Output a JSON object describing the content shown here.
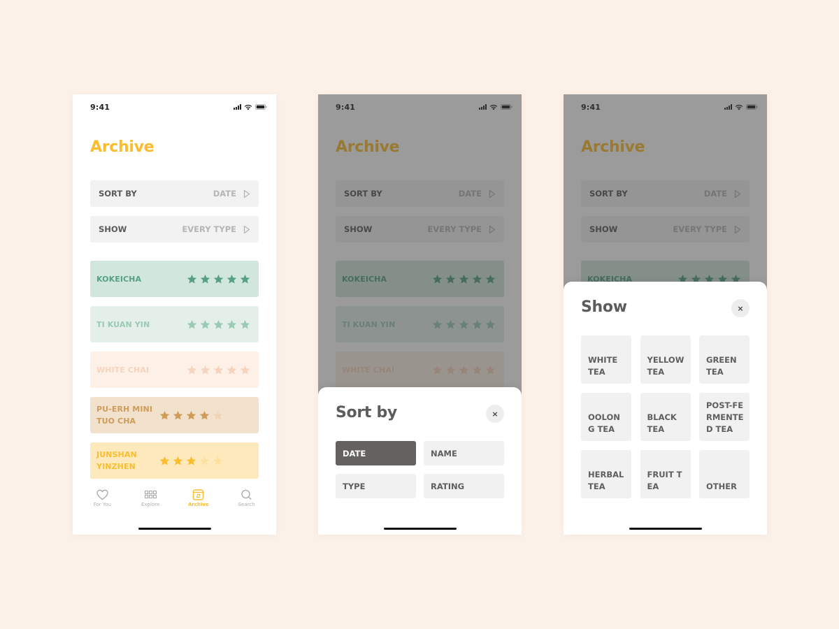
{
  "colors": {
    "background": "#fcf1e8",
    "accent": "#fbbd2f",
    "selected_option": "#64625e"
  },
  "status_bar": {
    "time": "9:41"
  },
  "archive": {
    "title": "Archive",
    "sort_row": {
      "label": "SORT BY",
      "value": "DATE"
    },
    "show_row": {
      "label": "SHOW",
      "value": "EVERY TYPE"
    },
    "teas": [
      {
        "name": "KOKEICHA",
        "rating": 5,
        "bg": "#d1e6dc",
        "text": "#57a182",
        "star_on": "#57a182",
        "star_off": "#bddbcd"
      },
      {
        "name": "TI KUAN YIN",
        "rating": 5,
        "bg": "#e3efe8",
        "text": "#9bcab2",
        "star_on": "#9bcab2",
        "star_off": "#cfe3d8"
      },
      {
        "name": "WHITE CHAI",
        "rating": 5,
        "bg": "#fdf0e7",
        "text": "#f6d3bc",
        "star_on": "#f6d3bc",
        "star_off": "#f9e2d3"
      },
      {
        "name": "PU-ERH MINI TUO CHA",
        "rating": 4,
        "bg": "#f2e1cc",
        "text": "#cf9c5a",
        "star_on": "#cf9c5a",
        "star_off": "#ecd6b8"
      },
      {
        "name": "JUNSHAN YINZHEN",
        "rating": 3,
        "bg": "#fee9bc",
        "text": "#fbbd2f",
        "star_on": "#fbbd2f",
        "star_off": "#fde0a1"
      }
    ]
  },
  "tab_bar": {
    "items": [
      {
        "label": "For You",
        "icon": "heart-icon",
        "active": false
      },
      {
        "label": "Explore",
        "icon": "grid-icon",
        "active": false
      },
      {
        "label": "Archive",
        "icon": "archive-box-icon",
        "active": true
      },
      {
        "label": "Search",
        "icon": "search-icon",
        "active": false
      }
    ]
  },
  "sort_sheet": {
    "title": "Sort by",
    "close_icon": "×",
    "options": [
      {
        "label": "DATE",
        "selected": true
      },
      {
        "label": "NAME",
        "selected": false
      },
      {
        "label": "TYPE",
        "selected": false
      },
      {
        "label": "RATING",
        "selected": false
      }
    ]
  },
  "show_sheet": {
    "title": "Show",
    "close_icon": "×",
    "options": [
      {
        "label": "WHITE TEA"
      },
      {
        "label": "YELLOW TEA"
      },
      {
        "label": "GREEN TEA"
      },
      {
        "label": "OOLONG TEA"
      },
      {
        "label": "BLACK TEA"
      },
      {
        "label": "POST-FERMENTED TEA"
      },
      {
        "label": "HERBAL TEA"
      },
      {
        "label": "FRUIT TEA"
      },
      {
        "label": "OTHER"
      }
    ]
  }
}
